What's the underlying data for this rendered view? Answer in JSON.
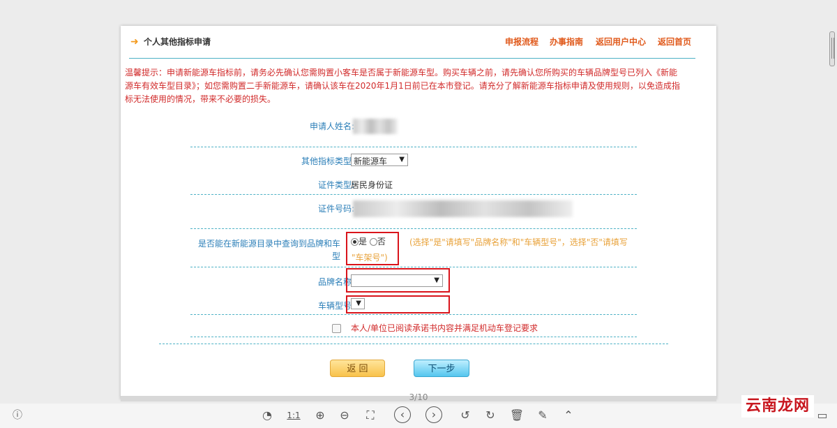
{
  "header": {
    "title": "个人其他指标申请",
    "nav": [
      "申报流程",
      "办事指南",
      "返回用户中心",
      "返回首页"
    ]
  },
  "notice": "温馨提示：申请新能源车指标前，请务必先确认您需购置小客车是否属于新能源车型。购买车辆之前，请先确认您所购买的车辆品牌型号已列入《新能源车有效车型目录》；如您需购置二手新能源车，请确认该车在2020年1月1日前已在本市登记。请充分了解新能源车指标申请及使用规则，以免造成指标无法使用的情况，带来不必要的损失。",
  "form": {
    "name_label": "申请人姓名:",
    "type_label": "其他指标类型:",
    "type_value": "新能源车",
    "cert_type_label": "证件类型:",
    "cert_type_value": "居民身份证",
    "cert_no_label": "证件号码:",
    "query_label": "是否能在新能源目录中查询到品牌和车型",
    "option_yes": "是",
    "option_no": "否",
    "query_hint_main": "(选择\"是\"请填写\"品牌名称\"和\"车辆型号\"，选择\"否\"请填写",
    "query_hint_tail": "\"车架号\")",
    "brand_label": "品牌名称:",
    "model_label": "车辆型号:",
    "agree_text": "本人/单位已阅读承诺书内容并满足机动车登记要求"
  },
  "buttons": {
    "back": "返 回",
    "next": "下一步"
  },
  "page_number": "3/10",
  "watermark": "云南龙网",
  "colors": {
    "accent_orange": "#f39a1d",
    "link_orange": "#e05a1c",
    "notice_red": "#d12a2a",
    "label_blue": "#2c7fb8",
    "highlight_red": "#d9141b"
  }
}
